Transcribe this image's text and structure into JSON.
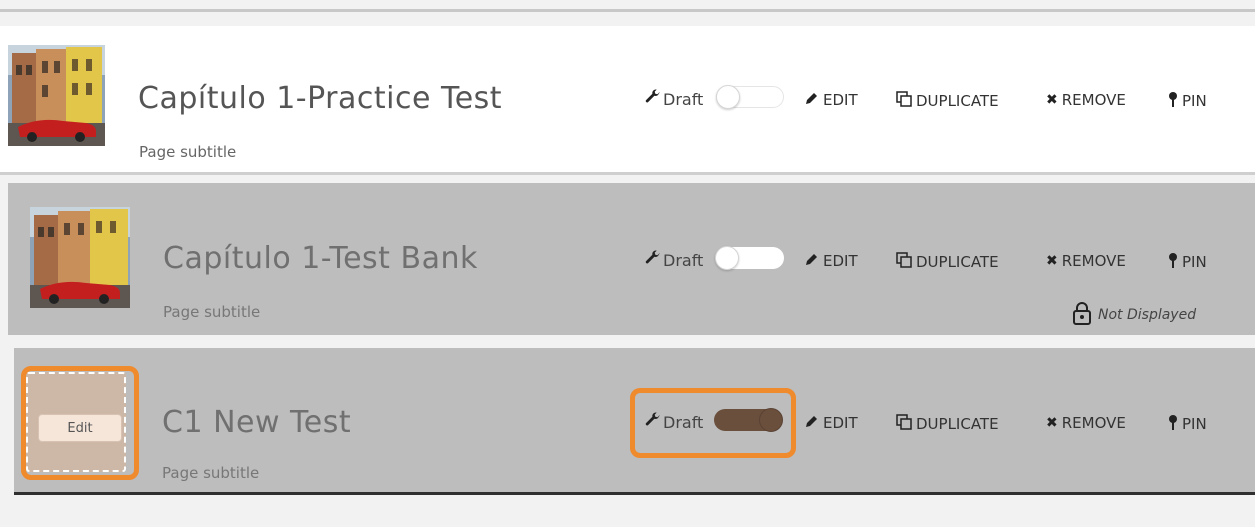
{
  "colors": {
    "accent_highlight": "#ef8a2d",
    "row_active_bg": "#ffffff",
    "row_inactive_bg": "#bdbdbd",
    "toggle_on": "#6b4f3d"
  },
  "pages": [
    {
      "title": "Capítulo 1-Practice Test",
      "subtitle": "Page subtitle",
      "draft_label": "Draft",
      "draft_on": false,
      "edit_label": "EDIT",
      "duplicate_label": "DUPLICATE",
      "remove_label": "REMOVE",
      "pin_label": "PIN",
      "thumbnail": "havana-street-classic-car"
    },
    {
      "title": "Capítulo 1-Test Bank",
      "subtitle": "Page subtitle",
      "draft_label": "Draft",
      "draft_on": false,
      "edit_label": "EDIT",
      "duplicate_label": "DUPLICATE",
      "remove_label": "REMOVE",
      "pin_label": "PIN",
      "status": "Not Displayed",
      "thumbnail": "havana-street-classic-car"
    },
    {
      "title": "C1 New Test",
      "subtitle": "Page subtitle",
      "draft_label": "Draft",
      "draft_on": true,
      "edit_label": "EDIT",
      "duplicate_label": "DUPLICATE",
      "remove_label": "REMOVE",
      "pin_label": "PIN",
      "thumbnail_edit_label": "Edit"
    }
  ]
}
